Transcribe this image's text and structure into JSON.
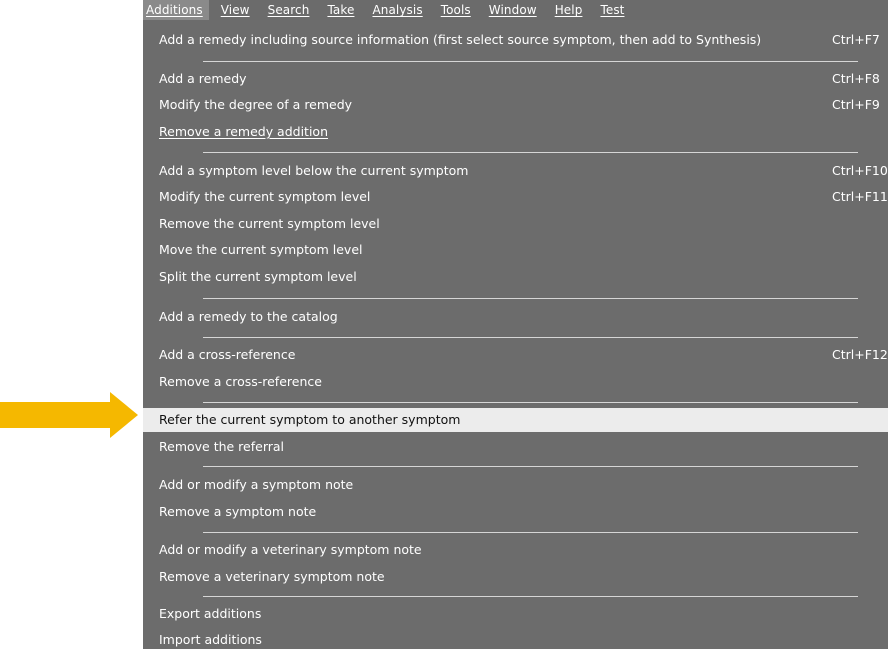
{
  "menubar": {
    "items": [
      {
        "label": "Additions",
        "active": true
      },
      {
        "label": "View"
      },
      {
        "label": "Search"
      },
      {
        "label": "Take"
      },
      {
        "label": "Analysis"
      },
      {
        "label": "Tools"
      },
      {
        "label": "Window"
      },
      {
        "label": "Help"
      },
      {
        "label": "Test"
      }
    ]
  },
  "menu": {
    "items": [
      {
        "label": "Add a remedy including source information (first select source symptom, then add to Synthesis)",
        "shortcut": "Ctrl+F7"
      },
      {
        "label": "Add a remedy",
        "shortcut": "Ctrl+F8"
      },
      {
        "label": "Modify the degree of a remedy",
        "shortcut": "Ctrl+F9"
      },
      {
        "label": "Remove a remedy addition",
        "shortcut": ""
      },
      {
        "label": "Add a symptom level below the current symptom",
        "shortcut": "Ctrl+F10"
      },
      {
        "label": "Modify the current symptom level",
        "shortcut": "Ctrl+F11"
      },
      {
        "label": "Remove the current symptom level",
        "shortcut": ""
      },
      {
        "label": "Move the current symptom level",
        "shortcut": ""
      },
      {
        "label": "Split the current symptom level",
        "shortcut": ""
      },
      {
        "label": "Add a remedy to the catalog",
        "shortcut": ""
      },
      {
        "label": "Add a cross-reference",
        "shortcut": "Ctrl+F12"
      },
      {
        "label": "Remove a cross-reference",
        "shortcut": ""
      },
      {
        "label": "Refer the current symptom to another symptom",
        "shortcut": "",
        "highlighted": true
      },
      {
        "label": "Remove the referral",
        "shortcut": ""
      },
      {
        "label": "Add or modify a symptom note",
        "shortcut": ""
      },
      {
        "label": "Remove a symptom note",
        "shortcut": ""
      },
      {
        "label": "Add or modify a veterinary symptom note",
        "shortcut": ""
      },
      {
        "label": "Remove a veterinary symptom note",
        "shortcut": ""
      },
      {
        "label": "Export additions",
        "shortcut": ""
      },
      {
        "label": "Import additions",
        "shortcut": ""
      }
    ]
  },
  "colors": {
    "menu_bg": "#6c6c6c",
    "highlight_bg": "#ececec",
    "arrow": "#f5b800"
  },
  "icons": {
    "pointer": "arrow-right-icon"
  }
}
